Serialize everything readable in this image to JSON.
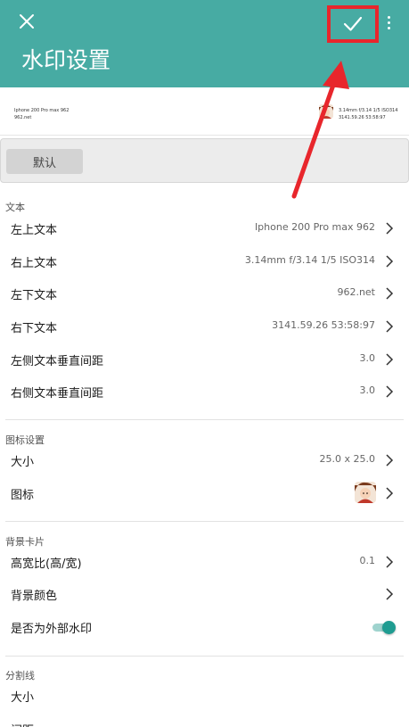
{
  "appbar": {
    "title": "水印设置",
    "background": "#47aba3",
    "close_icon": "close-icon",
    "confirm_icon": "check-icon",
    "more_icon": "more-vert-icon"
  },
  "preview": {
    "top_left": "Iphone 200 Pro max 962",
    "bottom_left": "962.net",
    "top_right": "3.14mm f/3.14 1/5 ISO314",
    "bottom_right": "3141.59.26 53:58:97"
  },
  "default_button": "默认",
  "text_section": {
    "header": "文本",
    "rows": [
      {
        "label": "左上文本",
        "value": "Iphone 200 Pro max 962"
      },
      {
        "label": "右上文本",
        "value": "3.14mm f/3.14 1/5 ISO314"
      },
      {
        "label": "左下文本",
        "value": "962.net"
      },
      {
        "label": "右下文本",
        "value": "3141.59.26 53:58:97"
      },
      {
        "label": "左侧文本垂直间距",
        "value": "3.0"
      },
      {
        "label": "右侧文本垂直间距",
        "value": "3.0"
      }
    ]
  },
  "icon_section": {
    "header": "图标设置",
    "size_label": "大小",
    "size_value": "25.0 x 25.0",
    "icon_label": "图标"
  },
  "card_section": {
    "header": "背景卡片",
    "ratio_label": "高宽比(高/宽)",
    "ratio_value": "0.1",
    "color_label": "背景颜色",
    "external_label": "是否为外部水印",
    "external_enabled": true
  },
  "divider_section": {
    "header": "分割线",
    "size_label": "大小",
    "spacing_label": "间距"
  },
  "colors": {
    "accent": "#47aba3",
    "toggle_on": "#1f9c91",
    "annotation": "#e8262c"
  }
}
